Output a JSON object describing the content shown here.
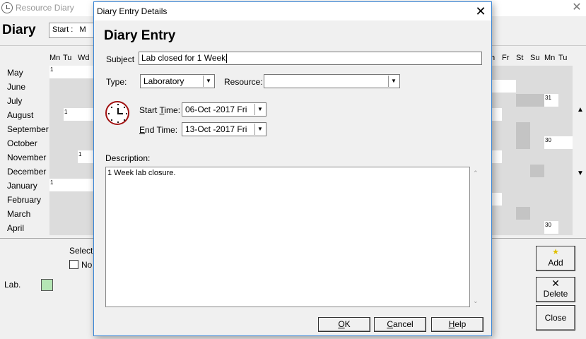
{
  "background_window": {
    "title": "Resource Diary",
    "close_glyph": "✕",
    "heading": "Diary",
    "start_label": "Start :",
    "start_value_partial": "M",
    "day_headers_left": [
      "Mn",
      "Tu",
      "Wd"
    ],
    "day_headers_right": [
      "h",
      "Fr",
      "St",
      "Su",
      "Mn",
      "Tu"
    ],
    "months": [
      "May",
      "June",
      "July",
      "August",
      "September",
      "October",
      "November",
      "December",
      "January",
      "February",
      "March",
      "April"
    ],
    "day_numbers_left": [
      "1",
      "1",
      "1",
      "1"
    ],
    "day_numbers_right": [
      "31",
      "30",
      "30"
    ],
    "legend_label": "Lab.",
    "legend_color": "#b5e6b5",
    "selected_label": "Selecte",
    "checkbox_label": "No",
    "buttons": {
      "add": "Add",
      "delete": "Delete",
      "close": "Close"
    },
    "scroll_up_glyph": "▲",
    "scroll_down_glyph": "▼"
  },
  "dialog": {
    "title": "Diary Entry Details",
    "close_glyph": "✕",
    "heading": "Diary Entry",
    "subject_label": "Subject",
    "subject_value": "Lab closed for 1 Week",
    "type_label": "Type:",
    "type_value": "Laboratory",
    "resource_label": "Resource:",
    "resource_value": "",
    "start_time_label_pre": "Start ",
    "start_time_label_u": "T",
    "start_time_label_post": "ime:",
    "start_time_value": "06-Oct -2017  Fri",
    "end_time_label_u": "E",
    "end_time_label_post": "nd Time:",
    "end_time_value": "13-Oct -2017  Fri",
    "description_label": "Description:",
    "description_value": "1 Week lab closure.",
    "dropdown_glyph": "▼",
    "buttons": {
      "ok_u": "O",
      "ok_rest": "K",
      "cancel_u": "C",
      "cancel_rest": "ancel",
      "help_u": "H",
      "help_rest": "elp"
    }
  }
}
